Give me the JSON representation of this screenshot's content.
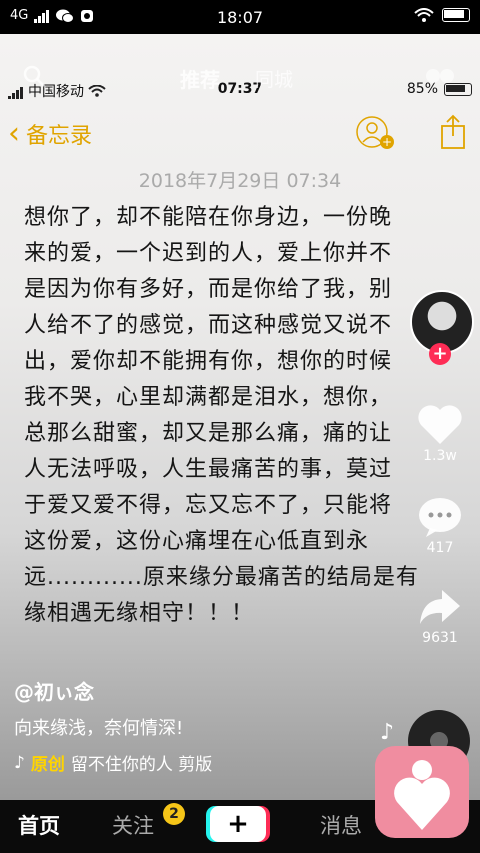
{
  "status_bar": {
    "network": "4G",
    "time": "18:07"
  },
  "inner_status": {
    "carrier": "中国移动",
    "time": "07:37",
    "battery": "85%"
  },
  "top_tabs": {
    "recommend": "推荐",
    "local": "同城"
  },
  "memo": {
    "back_label": "备忘录",
    "date": "2018年7月29日 07:34",
    "lines": [
      "想你了，却不能陪在你身边，一份晚",
      "来的爱，一个迟到的人，爱上你并不",
      "是因为你有多好，而是你给了我，别",
      "人给不了的感觉，而这种感觉又说不",
      "出，爱你却不能拥有你，想你的时候",
      "我不哭，心里却满都是泪水，想你，",
      "总那么甜蜜，却又是那么痛，痛的让",
      "人无法呼吸，人生最痛苦的事，莫过",
      "于爱又爱不得，忘又忘不了，只能将",
      "这份爱，这份心痛埋在心低直到永",
      "远............原来缘分最痛苦的结局是有",
      "缘相遇无缘相守！！！"
    ]
  },
  "side": {
    "likes": "1.3w",
    "comments": "417",
    "shares": "9631"
  },
  "post": {
    "author": "@初ぃ念",
    "caption": "向来缘浅，奈何情深!",
    "music_original": "原创",
    "music_title": "留不住你的人 剪版"
  },
  "nav": {
    "home": "首页",
    "follow": "关注",
    "follow_badge": "2",
    "add": "+",
    "messages": "消息"
  },
  "colors": {
    "accent_memo": "#e0a400",
    "like_red": "#fe2c55",
    "badge_yellow": "#f5c518"
  }
}
